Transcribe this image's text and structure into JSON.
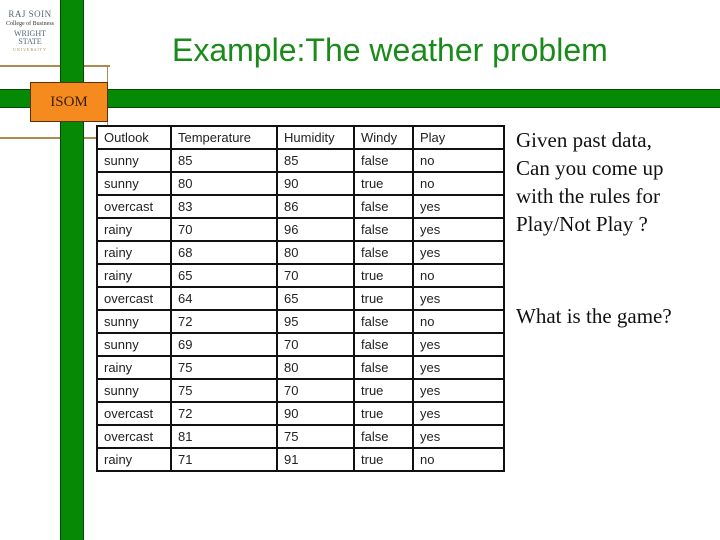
{
  "logo": {
    "line1": "RAJ SOIN",
    "line2": "College of Business",
    "line3": "WRIGHT STATE",
    "line4": "UNIVERSITY"
  },
  "badge": "ISOM",
  "title": "Example:The weather problem",
  "table": {
    "headers": [
      "Outlook",
      "Temperature",
      "Humidity",
      "Windy",
      "Play"
    ],
    "rows": [
      [
        "sunny",
        "85",
        "85",
        "false",
        "no"
      ],
      [
        "sunny",
        "80",
        "90",
        "true",
        "no"
      ],
      [
        "overcast",
        "83",
        "86",
        "false",
        "yes"
      ],
      [
        "rainy",
        "70",
        "96",
        "false",
        "yes"
      ],
      [
        "rainy",
        "68",
        "80",
        "false",
        "yes"
      ],
      [
        "rainy",
        "65",
        "70",
        "true",
        "no"
      ],
      [
        "overcast",
        "64",
        "65",
        "true",
        "yes"
      ],
      [
        "sunny",
        "72",
        "95",
        "false",
        "no"
      ],
      [
        "sunny",
        "69",
        "70",
        "false",
        "yes"
      ],
      [
        "rainy",
        "75",
        "80",
        "false",
        "yes"
      ],
      [
        "sunny",
        "75",
        "70",
        "true",
        "yes"
      ],
      [
        "overcast",
        "72",
        "90",
        "true",
        "yes"
      ],
      [
        "overcast",
        "81",
        "75",
        "false",
        "yes"
      ],
      [
        "rainy",
        "71",
        "91",
        "true",
        "no"
      ]
    ]
  },
  "side_text": {
    "question1": [
      "Given past data,",
      "Can you come up",
      "with the rules for",
      "Play/Not Play ?"
    ],
    "question2": "What is the game?"
  },
  "colors": {
    "green": "#068a06",
    "orange": "#f58a1e",
    "title_green": "#1a8a1a",
    "brown": "#b08850"
  }
}
